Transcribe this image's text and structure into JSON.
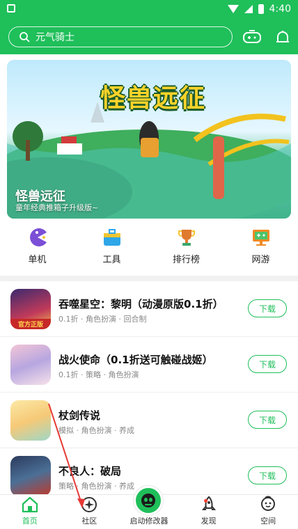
{
  "status_bar": {
    "time": "4:40"
  },
  "search": {
    "placeholder": "元气骑士"
  },
  "banner": {
    "logo_text": "怪兽远征",
    "title": "怪兽远征",
    "subtitle": "童年经典推箱子升级版~"
  },
  "categories": [
    {
      "label": "单机",
      "icon": "pacman-icon",
      "color": "#7b4fd6"
    },
    {
      "label": "工具",
      "icon": "toolbox-icon",
      "color": "#2fa6e8"
    },
    {
      "label": "排行榜",
      "icon": "trophy-icon",
      "color": "#e07a2e"
    },
    {
      "label": "网游",
      "icon": "monitor-icon",
      "color": "#f08a24"
    }
  ],
  "games": [
    {
      "name": "吞噬星空：黎明（动漫原版0.1折）",
      "tags": "0.1折 · 角色扮演 · 回合制",
      "badge": "官方正版",
      "download": "下载"
    },
    {
      "name": "战火使命（0.1折送可触碰战姬）",
      "tags": "0.1折 · 策略 · 角色扮演",
      "badge": "",
      "download": "下载"
    },
    {
      "name": "杖剑传说",
      "tags": "模拟 · 角色扮演 · 养成",
      "badge": "",
      "download": "下载"
    },
    {
      "name": "不良人：破局",
      "tags": "策略 · 角色扮演 · 养成",
      "badge": "",
      "download": "下载"
    }
  ],
  "tabs": [
    {
      "label": "首页",
      "icon": "home-icon"
    },
    {
      "label": "社区",
      "icon": "compass-icon"
    },
    {
      "label": "启动修改器",
      "icon": "launcher-icon"
    },
    {
      "label": "发现",
      "icon": "rocket-icon"
    },
    {
      "label": "空间",
      "icon": "profile-icon"
    }
  ],
  "colors": {
    "brand": "#1fbf5a",
    "annotation_arrow": "#e53935"
  }
}
